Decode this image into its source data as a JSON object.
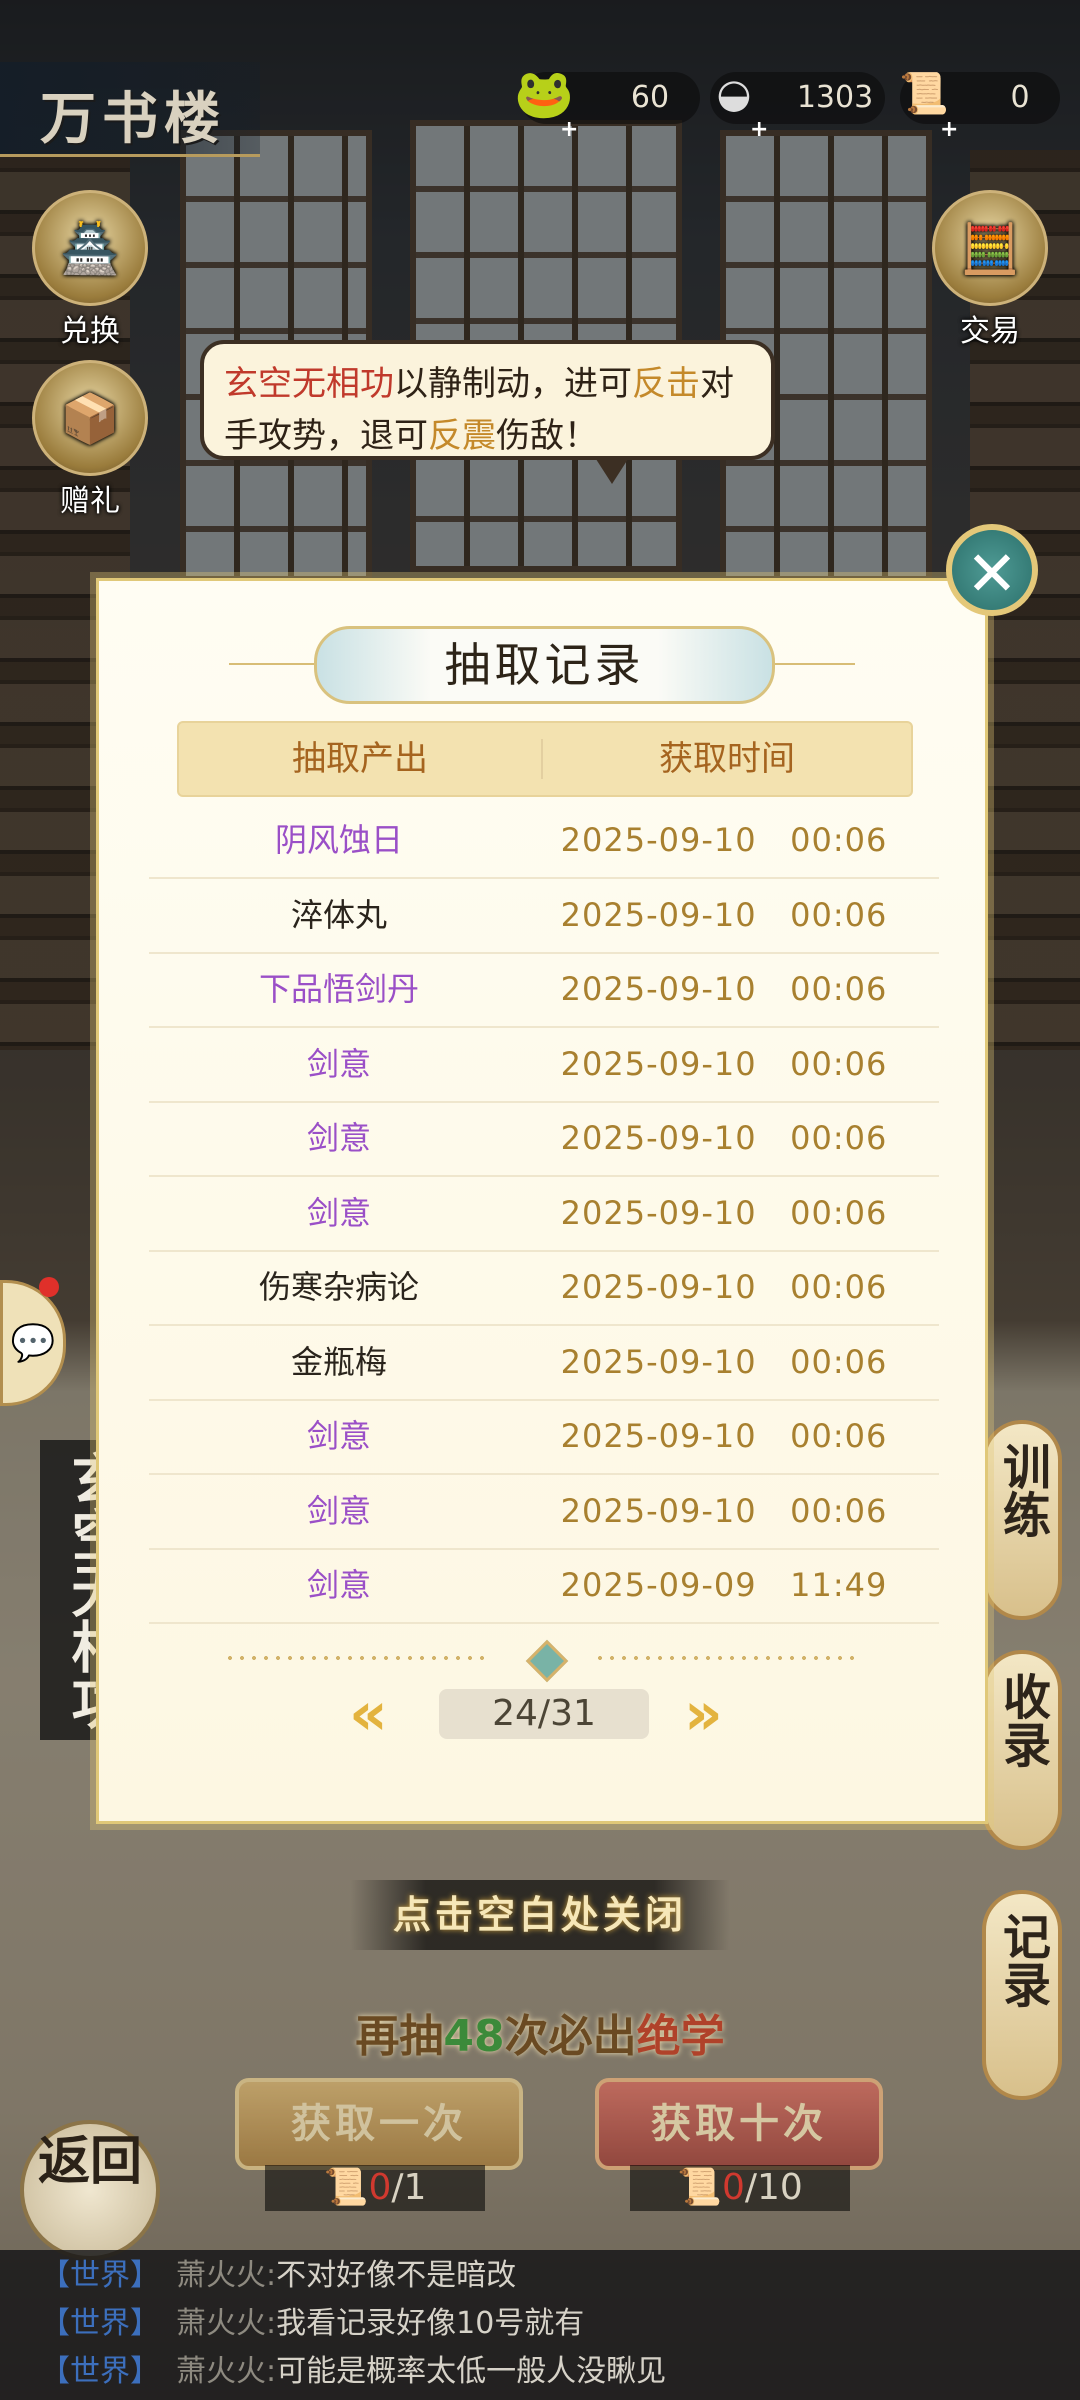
{
  "header": {
    "title": "万书楼",
    "resources": [
      {
        "icon": "jade-coin-icon",
        "value": "60"
      },
      {
        "icon": "silver-ingot-icon",
        "value": "1303"
      },
      {
        "icon": "book-token-icon",
        "value": "0"
      }
    ]
  },
  "side_buttons": {
    "exchange": "兑换",
    "gift": "赠礼",
    "trade": "交易"
  },
  "bubble": {
    "skill": "玄空无相功",
    "t1": "以静制动，进可",
    "k1": "反击",
    "t2": "对手攻势，退可",
    "k2": "反震",
    "t3": "伤敌！"
  },
  "modal": {
    "title": "抽取记录",
    "col_item": "抽取产出",
    "col_time": "获取时间",
    "rows": [
      {
        "item": "阴风蚀日",
        "time": "2025-09-10   00:06",
        "color": "#9a4fc7"
      },
      {
        "item": "淬体丸",
        "time": "2025-09-10   00:06",
        "color": "#2a241c"
      },
      {
        "item": "下品悟剑丹",
        "time": "2025-09-10   00:06",
        "color": "#9a4fc7"
      },
      {
        "item": "剑意",
        "time": "2025-09-10   00:06",
        "color": "#9a4fc7"
      },
      {
        "item": "剑意",
        "time": "2025-09-10   00:06",
        "color": "#9a4fc7"
      },
      {
        "item": "剑意",
        "time": "2025-09-10   00:06",
        "color": "#9a4fc7"
      },
      {
        "item": "伤寒杂病论",
        "time": "2025-09-10   00:06",
        "color": "#2a241c"
      },
      {
        "item": "金瓶梅",
        "time": "2025-09-10   00:06",
        "color": "#2a241c"
      },
      {
        "item": "剑意",
        "time": "2025-09-10   00:06",
        "color": "#9a4fc7"
      },
      {
        "item": "剑意",
        "time": "2025-09-10   00:06",
        "color": "#9a4fc7"
      },
      {
        "item": "剑意",
        "time": "2025-09-09   11:49",
        "color": "#9a4fc7"
      }
    ],
    "page": "24/31"
  },
  "bottom": {
    "close_hint": "点击空白处关闭",
    "pity_pre": "再抽",
    "pity_num": "48",
    "pity_mid": "次必出",
    "pity_rare": "绝学",
    "draw_one": "获取一次",
    "draw_ten": "获取十次",
    "cost_one_have": "0",
    "cost_one_need": "/1",
    "cost_ten_have": "0",
    "cost_ten_need": "/10",
    "back": "返回",
    "vertical_title": "玄空无相功",
    "tab_train": "训练",
    "tab_collect": "收录",
    "tab_record": "记录"
  },
  "chat": [
    {
      "channel": "【世界】",
      "name": "萧火火:",
      "text": "不对好像不是暗改"
    },
    {
      "channel": "【世界】",
      "name": "萧火火:",
      "text": "我看记录好像10号就有"
    },
    {
      "channel": "【世界】",
      "name": "萧火火:",
      "text": "可能是概率太低一般人没瞅见"
    }
  ],
  "colors": {
    "accent_gold": "#a5641f",
    "purple_rarity": "#9a4fc7",
    "time_text": "#a8802f"
  }
}
